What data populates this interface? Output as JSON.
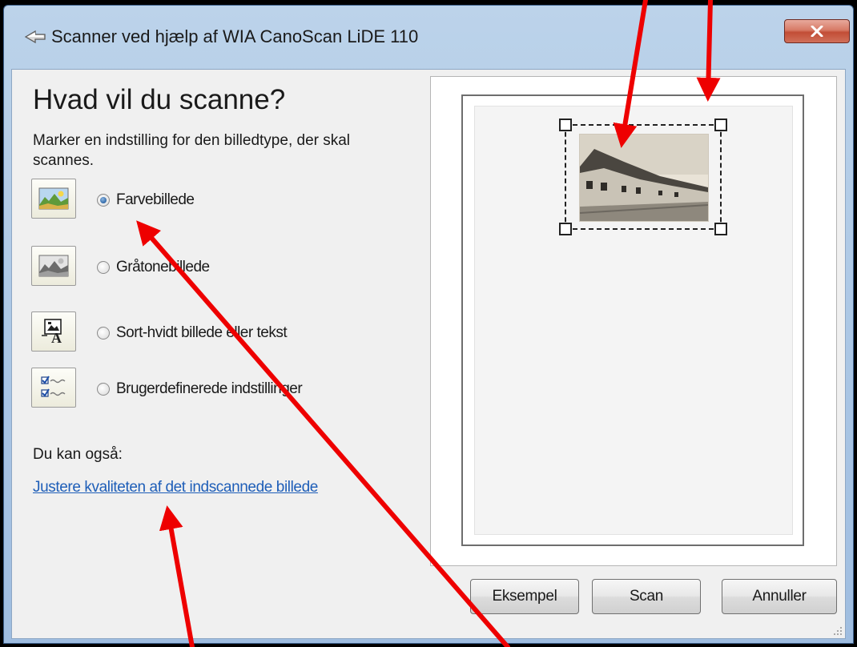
{
  "window": {
    "title": "Scanner ved hjælp af WIA CanoScan LiDE 110",
    "close_glyph": "x"
  },
  "main": {
    "heading": "Hvad vil du scanne?",
    "instruction": "Marker en indstilling for den billedtype, der skal scannes.",
    "options": [
      {
        "label": "Farvebillede",
        "icon": "color-picture-icon",
        "selected": true
      },
      {
        "label": "Gråtonebillede",
        "icon": "grayscale-picture-icon",
        "selected": false
      },
      {
        "label": "Sort-hvidt billede eller tekst",
        "icon": "black-white-text-icon",
        "selected": false
      },
      {
        "label": "Brugerdefinerede indstillinger",
        "icon": "custom-settings-icon",
        "selected": false
      }
    ],
    "also_label": "Du kan også:",
    "quality_link": "Justere kvaliteten af det indscannede billede"
  },
  "buttons": {
    "preview": "Eksempel",
    "scan": "Scan",
    "cancel": "Annuller"
  },
  "colors": {
    "link": "#1e5eb8",
    "annotation_arrow": "#ee0000",
    "close_button": "#c24d36"
  }
}
